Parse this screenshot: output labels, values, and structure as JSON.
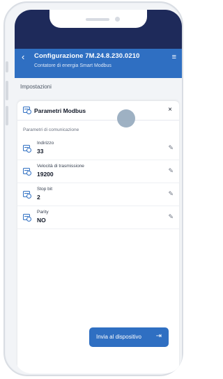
{
  "header": {
    "title": "Configurazione 7M.24.8.230.0210",
    "subtitle": "Contatore di energia Smart Modbus",
    "back_icon": "chevron-left-icon",
    "filter_icon": "filter-list-icon"
  },
  "section": {
    "title": "Impostazioni"
  },
  "panel": {
    "title": "Parametri Modbus",
    "close": "×",
    "group_label": "Parametri di comunicazione",
    "rows": [
      {
        "label": "Indirizzo",
        "value": "33"
      },
      {
        "label": "Velocità di trasmissione",
        "value": "19200"
      },
      {
        "label": "Stop bit",
        "value": "2"
      },
      {
        "label": "Parity",
        "value": "NO"
      }
    ]
  },
  "action": {
    "send_label": "Invia al dispositivo"
  },
  "colors": {
    "primary": "#2f6fc2",
    "dark_header": "#1e2a5a",
    "background": "#f2f4f7"
  }
}
